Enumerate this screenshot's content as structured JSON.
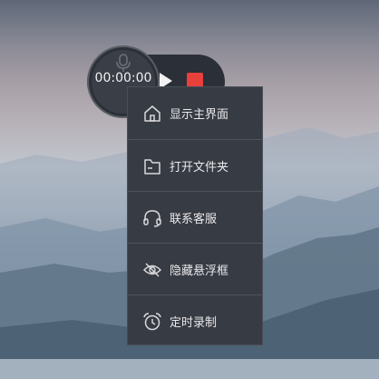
{
  "widget": {
    "timer": "00:00:00",
    "play_icon": "play-icon",
    "stop_icon": "stop-icon",
    "stop_color": "#e8403a",
    "mic_icon": "microphone-icon"
  },
  "menu": {
    "items": [
      {
        "label": "显示主界面",
        "icon": "home-icon"
      },
      {
        "label": "打开文件夹",
        "icon": "folder-icon"
      },
      {
        "label": "联系客服",
        "icon": "headset-icon"
      },
      {
        "label": "隐藏悬浮框",
        "icon": "eye-off-icon"
      },
      {
        "label": "定时录制",
        "icon": "alarm-clock-icon"
      }
    ]
  }
}
